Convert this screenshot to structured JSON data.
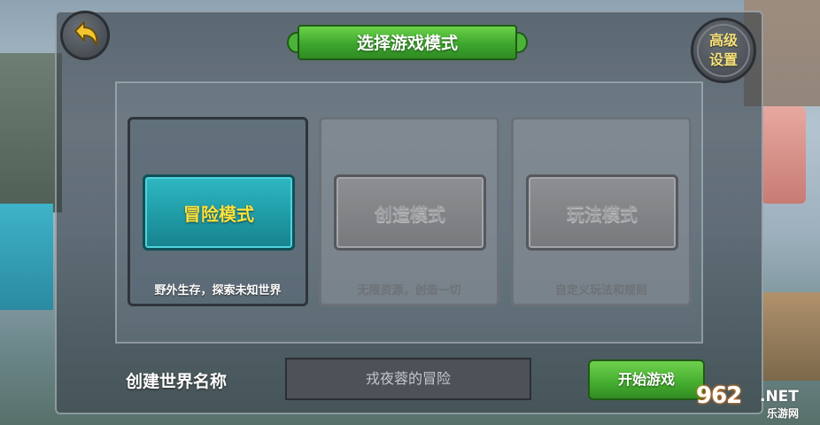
{
  "header": {
    "title": "选择游戏模式",
    "advanced_settings_label": "高级\n设置"
  },
  "modes": [
    {
      "label": "冒险模式",
      "description": "野外生存，探索未知世界",
      "state": "selected"
    },
    {
      "label": "创造模式",
      "description": "无限资源，创造一切",
      "state": "disabled"
    },
    {
      "label": "玩法模式",
      "description": "自定义玩法和规则",
      "state": "disabled"
    }
  ],
  "world": {
    "name_label": "创建世界名称",
    "name_value": "戎夜蓉的冒险"
  },
  "actions": {
    "start_label": "开始游戏"
  },
  "watermark": {
    "logo": "962",
    "domain": ".NET",
    "site_name": "乐游网"
  },
  "icons": {
    "back": "back-arrow-icon"
  },
  "colors": {
    "accent_green": "#43ac2f",
    "selected_teal": "#1e98a3",
    "selected_label": "#ffe23a",
    "advanced_label": "#f6e27a"
  }
}
